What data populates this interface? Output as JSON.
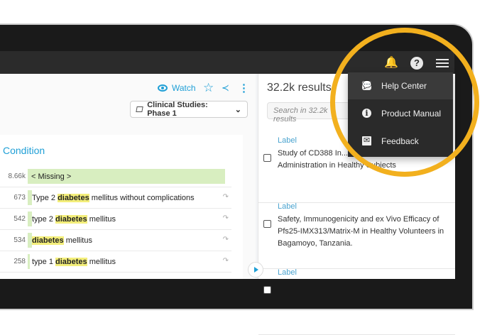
{
  "header": {
    "icons": [
      "bell-icon",
      "help-icon",
      "menu-icon"
    ]
  },
  "dataset": {
    "watch_label": "Watch",
    "selector_label": "Clinical Studies: Phase 1"
  },
  "facet": {
    "title": "Condition",
    "rows": [
      {
        "count": "8.66k",
        "pre": "< Missing >",
        "hl": "",
        "post": "",
        "bar": 1.0
      },
      {
        "count": "673",
        "pre": "Type 2 ",
        "hl": "diabetes",
        "post": " mellitus without complications",
        "bar": 0.02
      },
      {
        "count": "542",
        "pre": "type 2 ",
        "hl": "diabetes",
        "post": " mellitus",
        "bar": 0.02
      },
      {
        "count": "534",
        "pre": "",
        "hl": "diabetes",
        "post": " mellitus",
        "bar": 0.02
      },
      {
        "count": "258",
        "pre": "type 1 ",
        "hl": "diabetes",
        "post": " mellitus",
        "bar": 0.01
      }
    ]
  },
  "results": {
    "title": "32.2k results",
    "search_placeholder": "Search in 32.2k results",
    "items": [
      {
        "label": "Label",
        "text": "Study of CD388 In... Subcutaneous Administration in Healthy Subjects"
      },
      {
        "label": "Label",
        "text": "Safety, Immunogenicity and ex Vivo Efficacy of Pfs25-IMX313/Matrix-M in Healthy Volunteers in Bagamoyo, Tanzania."
      },
      {
        "label": "Label",
        "text": ""
      }
    ]
  },
  "menu": {
    "items": [
      {
        "label": "Help Center",
        "icon": "chat-icon"
      },
      {
        "label": "Product Manual",
        "icon": "info-icon"
      },
      {
        "label": "Feedback",
        "icon": "mail-icon"
      }
    ]
  },
  "colors": {
    "accent": "#1f9fd6",
    "highlight_ring": "#f2b01e",
    "bar": "#d8eec0"
  }
}
